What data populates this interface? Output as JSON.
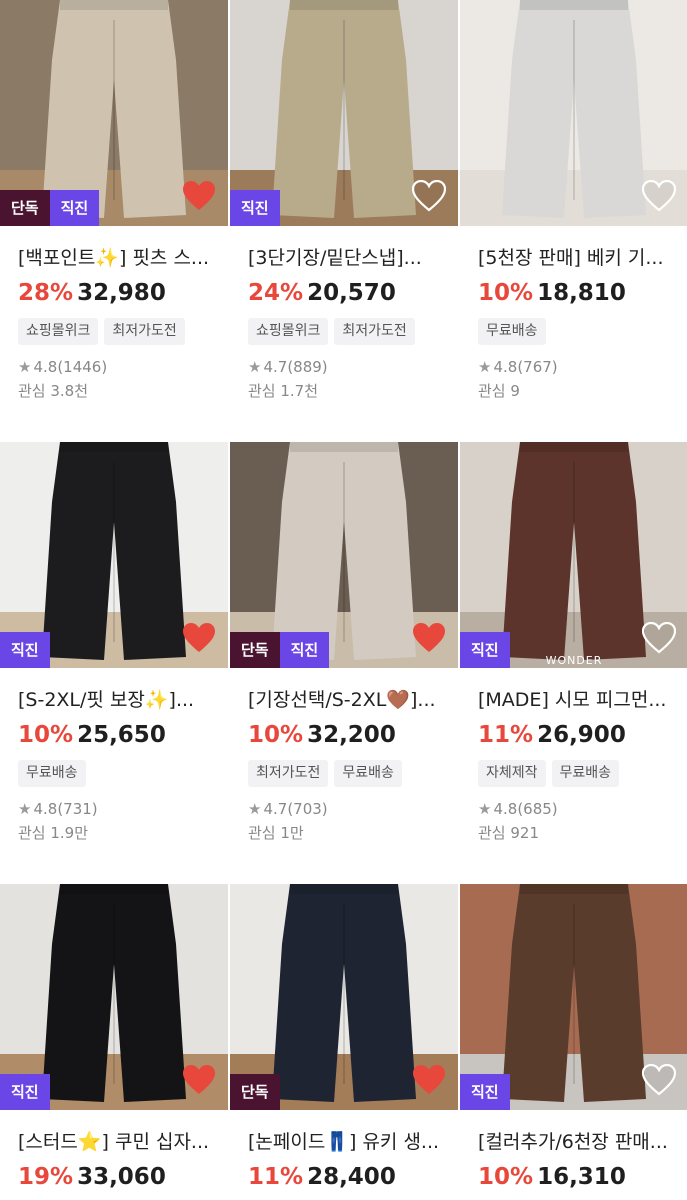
{
  "products": [
    {
      "title": "[백포인트✨] 핏츠 스...",
      "discount": "28%",
      "price": "32,980",
      "badges": [
        "단독",
        "직진"
      ],
      "liked": true,
      "tags": [
        "쇼핑몰위크",
        "최저가도전"
      ],
      "rating": "4.8",
      "reviews": "(1446)",
      "likes": "관심 3.8천",
      "colors": {
        "bg": "#8b7a66",
        "item": "#cfc3b0",
        "floor": "#a88a68"
      }
    },
    {
      "title": "[3단기장/밑단스냅]...",
      "discount": "24%",
      "price": "20,570",
      "badges": [
        "직진"
      ],
      "liked": false,
      "tags": [
        "쇼핑몰위크",
        "최저가도전"
      ],
      "rating": "4.7",
      "reviews": "(889)",
      "likes": "관심 1.7천",
      "colors": {
        "bg": "#d8d4cf",
        "item": "#b8ab8c",
        "floor": "#9c7b5a"
      }
    },
    {
      "title": "[5천장 판매] 베키 기...",
      "discount": "10%",
      "price": "18,810",
      "badges": [],
      "liked": false,
      "tags": [
        "무료배송"
      ],
      "rating": "4.8",
      "reviews": "(767)",
      "likes": "관심 9",
      "colors": {
        "bg": "#ece9e4",
        "item": "#d9d8d6",
        "floor": "#e2ddd6"
      }
    },
    {
      "title": "[S-2XL/핏 보장✨]...",
      "discount": "10%",
      "price": "25,650",
      "badges": [
        "직진"
      ],
      "liked": true,
      "tags": [
        "무료배송"
      ],
      "rating": "4.8",
      "reviews": "(731)",
      "likes": "관심 1.9만",
      "colors": {
        "bg": "#eeeeec",
        "item": "#1c1c1e",
        "floor": "#cdbba2"
      }
    },
    {
      "title": "[기장선택/S-2XL🤎]...",
      "discount": "10%",
      "price": "32,200",
      "badges": [
        "단독",
        "직진"
      ],
      "liked": true,
      "tags": [
        "최저가도전",
        "무료배송"
      ],
      "rating": "4.7",
      "reviews": "(703)",
      "likes": "관심 1만",
      "colors": {
        "bg": "#6a5d52",
        "item": "#d3cbc1",
        "floor": "#c9bca9"
      }
    },
    {
      "title": "[MADE] 시모 피그먼...",
      "discount": "11%",
      "price": "26,900",
      "badges": [
        "직진"
      ],
      "liked": false,
      "tags": [
        "자체제작",
        "무료배송"
      ],
      "rating": "4.8",
      "reviews": "(685)",
      "likes": "관심 921",
      "colors": {
        "bg": "#d7d1c9",
        "item": "#5c342b",
        "floor": "#b9aea2"
      },
      "watermark": "WONDER"
    },
    {
      "title": "[스터드⭐] 쿠민 십자...",
      "discount": "19%",
      "price": "33,060",
      "badges": [
        "직진"
      ],
      "liked": true,
      "tags": [],
      "rating": "",
      "reviews": "",
      "likes": "",
      "colors": {
        "bg": "#e4e2df",
        "item": "#141416",
        "floor": "#b08c69"
      }
    },
    {
      "title": "[논페이드👖] 유키 생...",
      "discount": "11%",
      "price": "28,400",
      "badges": [
        "단독"
      ],
      "liked": true,
      "tags": [],
      "rating": "",
      "reviews": "",
      "likes": "",
      "colors": {
        "bg": "#eae8e4",
        "item": "#1f2433",
        "floor": "#a27d58"
      }
    },
    {
      "title": "[컬러추가/6천장 판매...",
      "discount": "10%",
      "price": "16,310",
      "badges": [
        "직진"
      ],
      "liked": false,
      "tags": [],
      "rating": "",
      "reviews": "",
      "likes": "",
      "colors": {
        "bg": "#a76b52",
        "item": "#5a3c2c",
        "floor": "#c8c4bf"
      }
    }
  ]
}
